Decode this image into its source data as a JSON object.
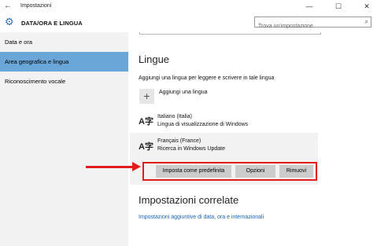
{
  "titlebar": {
    "back_icon": "←",
    "title": "Impostazioni",
    "minimize_icon": "—",
    "maximize_icon": "☐",
    "close_icon": "✕"
  },
  "header": {
    "gear_icon": "⚙",
    "title": "DATA/ORA E LINGUA",
    "search_placeholder": "Trova un'impostazione",
    "search_icon": "⌕"
  },
  "sidebar": {
    "items": [
      {
        "label": "Data e ora"
      },
      {
        "label": "Area geografica e lingua"
      },
      {
        "label": "Riconoscimento vocale"
      }
    ]
  },
  "main": {
    "section_title": "Lingue",
    "description": "Aggiungi una lingua per leggere e scrivere in tale lingua",
    "add_language": {
      "icon": "+",
      "label": "Aggiungi una lingua"
    },
    "languages": [
      {
        "icon": "A字",
        "name": "Italiano (Italia)",
        "status": "Lingua di visualizzazione di Windows"
      },
      {
        "icon": "A字",
        "name": "Français (France)",
        "status": "Ricerca in Windows Update"
      }
    ],
    "buttons": {
      "set_default": "Imposta come predefinita",
      "options": "Opzioni",
      "remove": "Rimuovi"
    },
    "related_title": "Impostazioni correlate",
    "related_link": "Impostazioni aggiuntive di data, ora e internazionali"
  },
  "colors": {
    "accent": "#2a70b8",
    "selected_nav": "#6aa6d8",
    "highlight": "#e31b1b",
    "link": "#1a63b4"
  }
}
